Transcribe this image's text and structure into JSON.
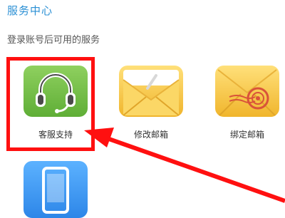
{
  "page": {
    "title": "服务中心",
    "subtitle": "登录账号后可用的服务"
  },
  "services": [
    {
      "label": "客服支持",
      "icon": "headset-icon",
      "color": "#6cbd44"
    },
    {
      "label": "修改邮箱",
      "icon": "open-envelope-icon",
      "color": "#f5c341"
    },
    {
      "label": "绑定邮箱",
      "icon": "sealed-envelope-icon",
      "color": "#f5c341"
    },
    {
      "label": "",
      "icon": "mobile-phone-icon",
      "color": "#3a97f2"
    }
  ],
  "annotation": {
    "highlight_color": "#ff1010",
    "arrow_color": "#ff1010"
  }
}
